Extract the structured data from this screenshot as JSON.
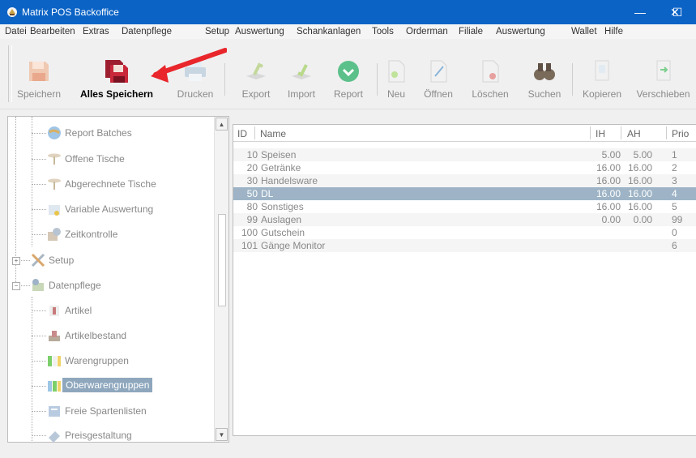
{
  "window": {
    "title": "Matrix POS Backoffice",
    "minimize": "—",
    "maximize": "☐",
    "close": "✕"
  },
  "menu": [
    "Datei",
    "Bearbeiten",
    "Extras",
    "Datenpflege",
    "Setup",
    "Auswertung",
    "Schankanlagen",
    "Tools",
    "Orderman",
    "Filiale",
    "Auswertung",
    "Wallet",
    "Hilfe"
  ],
  "toolbar": {
    "speichern": "Speichern",
    "alles_speichern": "Alles Speichern",
    "drucken": "Drucken",
    "export": "Export",
    "import": "Import",
    "report": "Report",
    "neu": "Neu",
    "oeffnen": "Öffnen",
    "loeschen": "Löschen",
    "suchen": "Suchen",
    "kopieren": "Kopieren",
    "verschieben": "Verschieben"
  },
  "tree": {
    "report_batches": "Report Batches",
    "offene_tische": "Offene Tische",
    "abgerechnete_tische": "Abgerechnete Tische",
    "variable_auswertung": "Variable Auswertung",
    "zeitkontrolle": "Zeitkontrolle",
    "setup": "Setup",
    "datenpflege": "Datenpflege",
    "artikel": "Artikel",
    "artikelbestand": "Artikelbestand",
    "warengruppen": "Warengruppen",
    "oberwarengruppen": "Oberwarengruppen",
    "freie_spartenlisten": "Freie Spartenlisten",
    "preisgestaltung": "Preisgestaltung"
  },
  "grid": {
    "headers": {
      "id": "ID",
      "name": "Name",
      "ih": "IH",
      "ah": "AH",
      "prio": "Prio"
    },
    "rows": [
      {
        "id": "10",
        "name": "Speisen",
        "ih": "5.00",
        "ah": "5.00",
        "prio": "1"
      },
      {
        "id": "20",
        "name": "Getränke",
        "ih": "16.00",
        "ah": "16.00",
        "prio": "2"
      },
      {
        "id": "30",
        "name": "Handelsware",
        "ih": "16.00",
        "ah": "16.00",
        "prio": "3"
      },
      {
        "id": "50",
        "name": "DL",
        "ih": "16.00",
        "ah": "16.00",
        "prio": "4"
      },
      {
        "id": "80",
        "name": "Sonstiges",
        "ih": "16.00",
        "ah": "16.00",
        "prio": "5"
      },
      {
        "id": "99",
        "name": "Auslagen",
        "ih": "0.00",
        "ah": "0.00",
        "prio": "99"
      },
      {
        "id": "100",
        "name": "Gutschein",
        "ih": "",
        "ah": "",
        "prio": "0"
      },
      {
        "id": "101",
        "name": "Gänge Monitor",
        "ih": "",
        "ah": "",
        "prio": "6"
      }
    ]
  },
  "colors": {
    "titlebar": "#0b63c6",
    "selection": "#9eb4c6",
    "arrow": "#e8262b"
  }
}
